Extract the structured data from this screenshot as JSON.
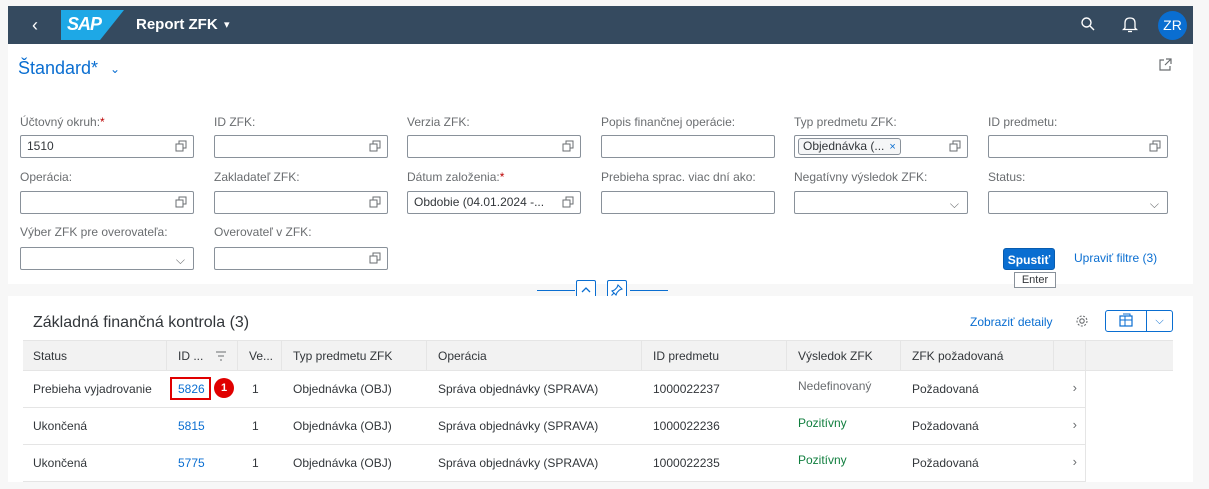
{
  "shell": {
    "back_glyph": "‹",
    "logo_text": "SAP",
    "app_title": "Report ZFK",
    "title_caret": "▾",
    "avatar_initials": "ZR",
    "icons": [
      "back-icon",
      "search-icon",
      "bell-icon"
    ]
  },
  "header": {
    "variant_name": "Štandard*",
    "variant_caret": "⌄"
  },
  "filters": {
    "ucet_okruh": {
      "label": "Účtovný okruh:",
      "required": "*",
      "value": "1510"
    },
    "id_zfk": {
      "label": "ID ZFK:",
      "value": ""
    },
    "verzia_zfk": {
      "label": "Verzia ZFK:",
      "value": ""
    },
    "popis": {
      "label": "Popis finančnej operácie:",
      "value": ""
    },
    "typ_predmetu": {
      "label": "Typ predmetu ZFK:",
      "token": "Objednávka (...",
      "token_close": "×"
    },
    "id_predmetu": {
      "label": "ID predmetu:",
      "value": ""
    },
    "operacia": {
      "label": "Operácia:",
      "value": ""
    },
    "zakladatel": {
      "label": "Zakladateľ ZFK:",
      "value": ""
    },
    "datum": {
      "label": "Dátum založenia:",
      "required": "*",
      "value": "Obdobie (04.01.2024 -..."
    },
    "prebieha": {
      "label": "Prebieha sprac. viac dní ako:",
      "value": ""
    },
    "negativny": {
      "label": "Negatívny výsledok ZFK:",
      "value": ""
    },
    "status": {
      "label": "Status:",
      "value": ""
    },
    "vyber": {
      "label": "Výber ZFK pre overovateľa:",
      "value": ""
    },
    "overovatel": {
      "label": "Overovateľ v ZFK:",
      "value": ""
    },
    "dropdown_glyph": "⌵"
  },
  "filterbar": {
    "go_label": "Spustiť",
    "go_tooltip": "Enter",
    "adapt_label": "Upraviť filtre (3)"
  },
  "table": {
    "title": "Základná finančná kontrola (3)",
    "details_link": "Zobraziť detaily",
    "export_caret": "⌵",
    "columns": [
      "Status",
      "ID ...",
      "Ve...",
      "Typ predmetu ZFK",
      "Operácia",
      "ID predmetu",
      "Výsledok ZFK",
      "ZFK požadovaná"
    ],
    "rows": [
      {
        "status": "Prebieha vyjadrovanie",
        "id": "5826",
        "ver": "1",
        "typ": "Objednávka (OBJ)",
        "operacia": "Správa objednávky (SPRAVA)",
        "id_predmetu": "1000022237",
        "vysledok": "Nedefinovaný",
        "pozadovana": "Požadovaná"
      },
      {
        "status": "Ukončená",
        "id": "5815",
        "ver": "1",
        "typ": "Objednávka (OBJ)",
        "operacia": "Správa objednávky (SPRAVA)",
        "id_predmetu": "1000022236",
        "vysledok": "Pozitívny",
        "pozadovana": "Požadovaná"
      },
      {
        "status": "Ukončená",
        "id": "5775",
        "ver": "1",
        "typ": "Objednávka (OBJ)",
        "operacia": "Správa objednávky (SPRAVA)",
        "id_predmetu": "1000022235",
        "vysledok": "Pozitívny",
        "pozadovana": "Požadovaná"
      }
    ],
    "row_chevron": "›"
  },
  "annotation": {
    "marker_number": "1"
  },
  "colors": {
    "shell": "#354a5f",
    "accent": "#0a6ed1",
    "positive": "#107e3e",
    "highlight": "#e00000"
  }
}
